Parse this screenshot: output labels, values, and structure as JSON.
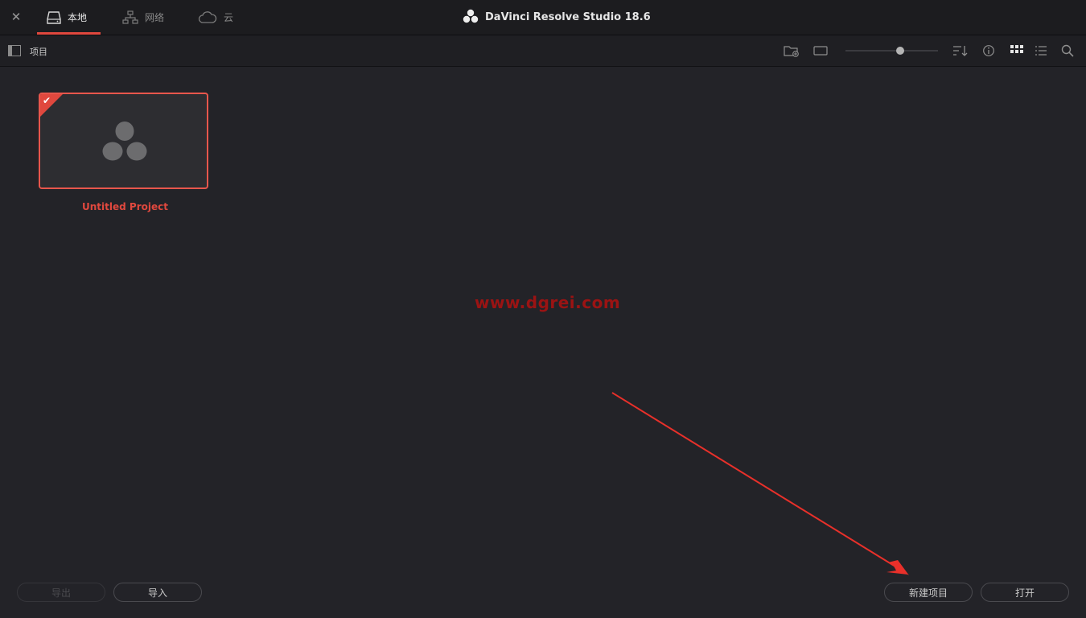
{
  "window": {
    "title": "DaVinci Resolve Studio 18.6"
  },
  "tabs": [
    {
      "label": "本地",
      "icon": "drive-icon",
      "active": true
    },
    {
      "label": "网络",
      "icon": "network-icon",
      "active": false
    },
    {
      "label": "云",
      "icon": "cloud-icon",
      "active": false
    }
  ],
  "toolbar": {
    "section_label": "项目",
    "zoom_level": 0.59
  },
  "projects": [
    {
      "name": "Untitled Project",
      "selected": true
    }
  ],
  "watermark": "www.dgrei.com",
  "buttons": {
    "export": "导出",
    "import": "导入",
    "new_project": "新建项目",
    "open": "打开"
  },
  "colors": {
    "accent": "#e0483e",
    "background": "#232328"
  }
}
